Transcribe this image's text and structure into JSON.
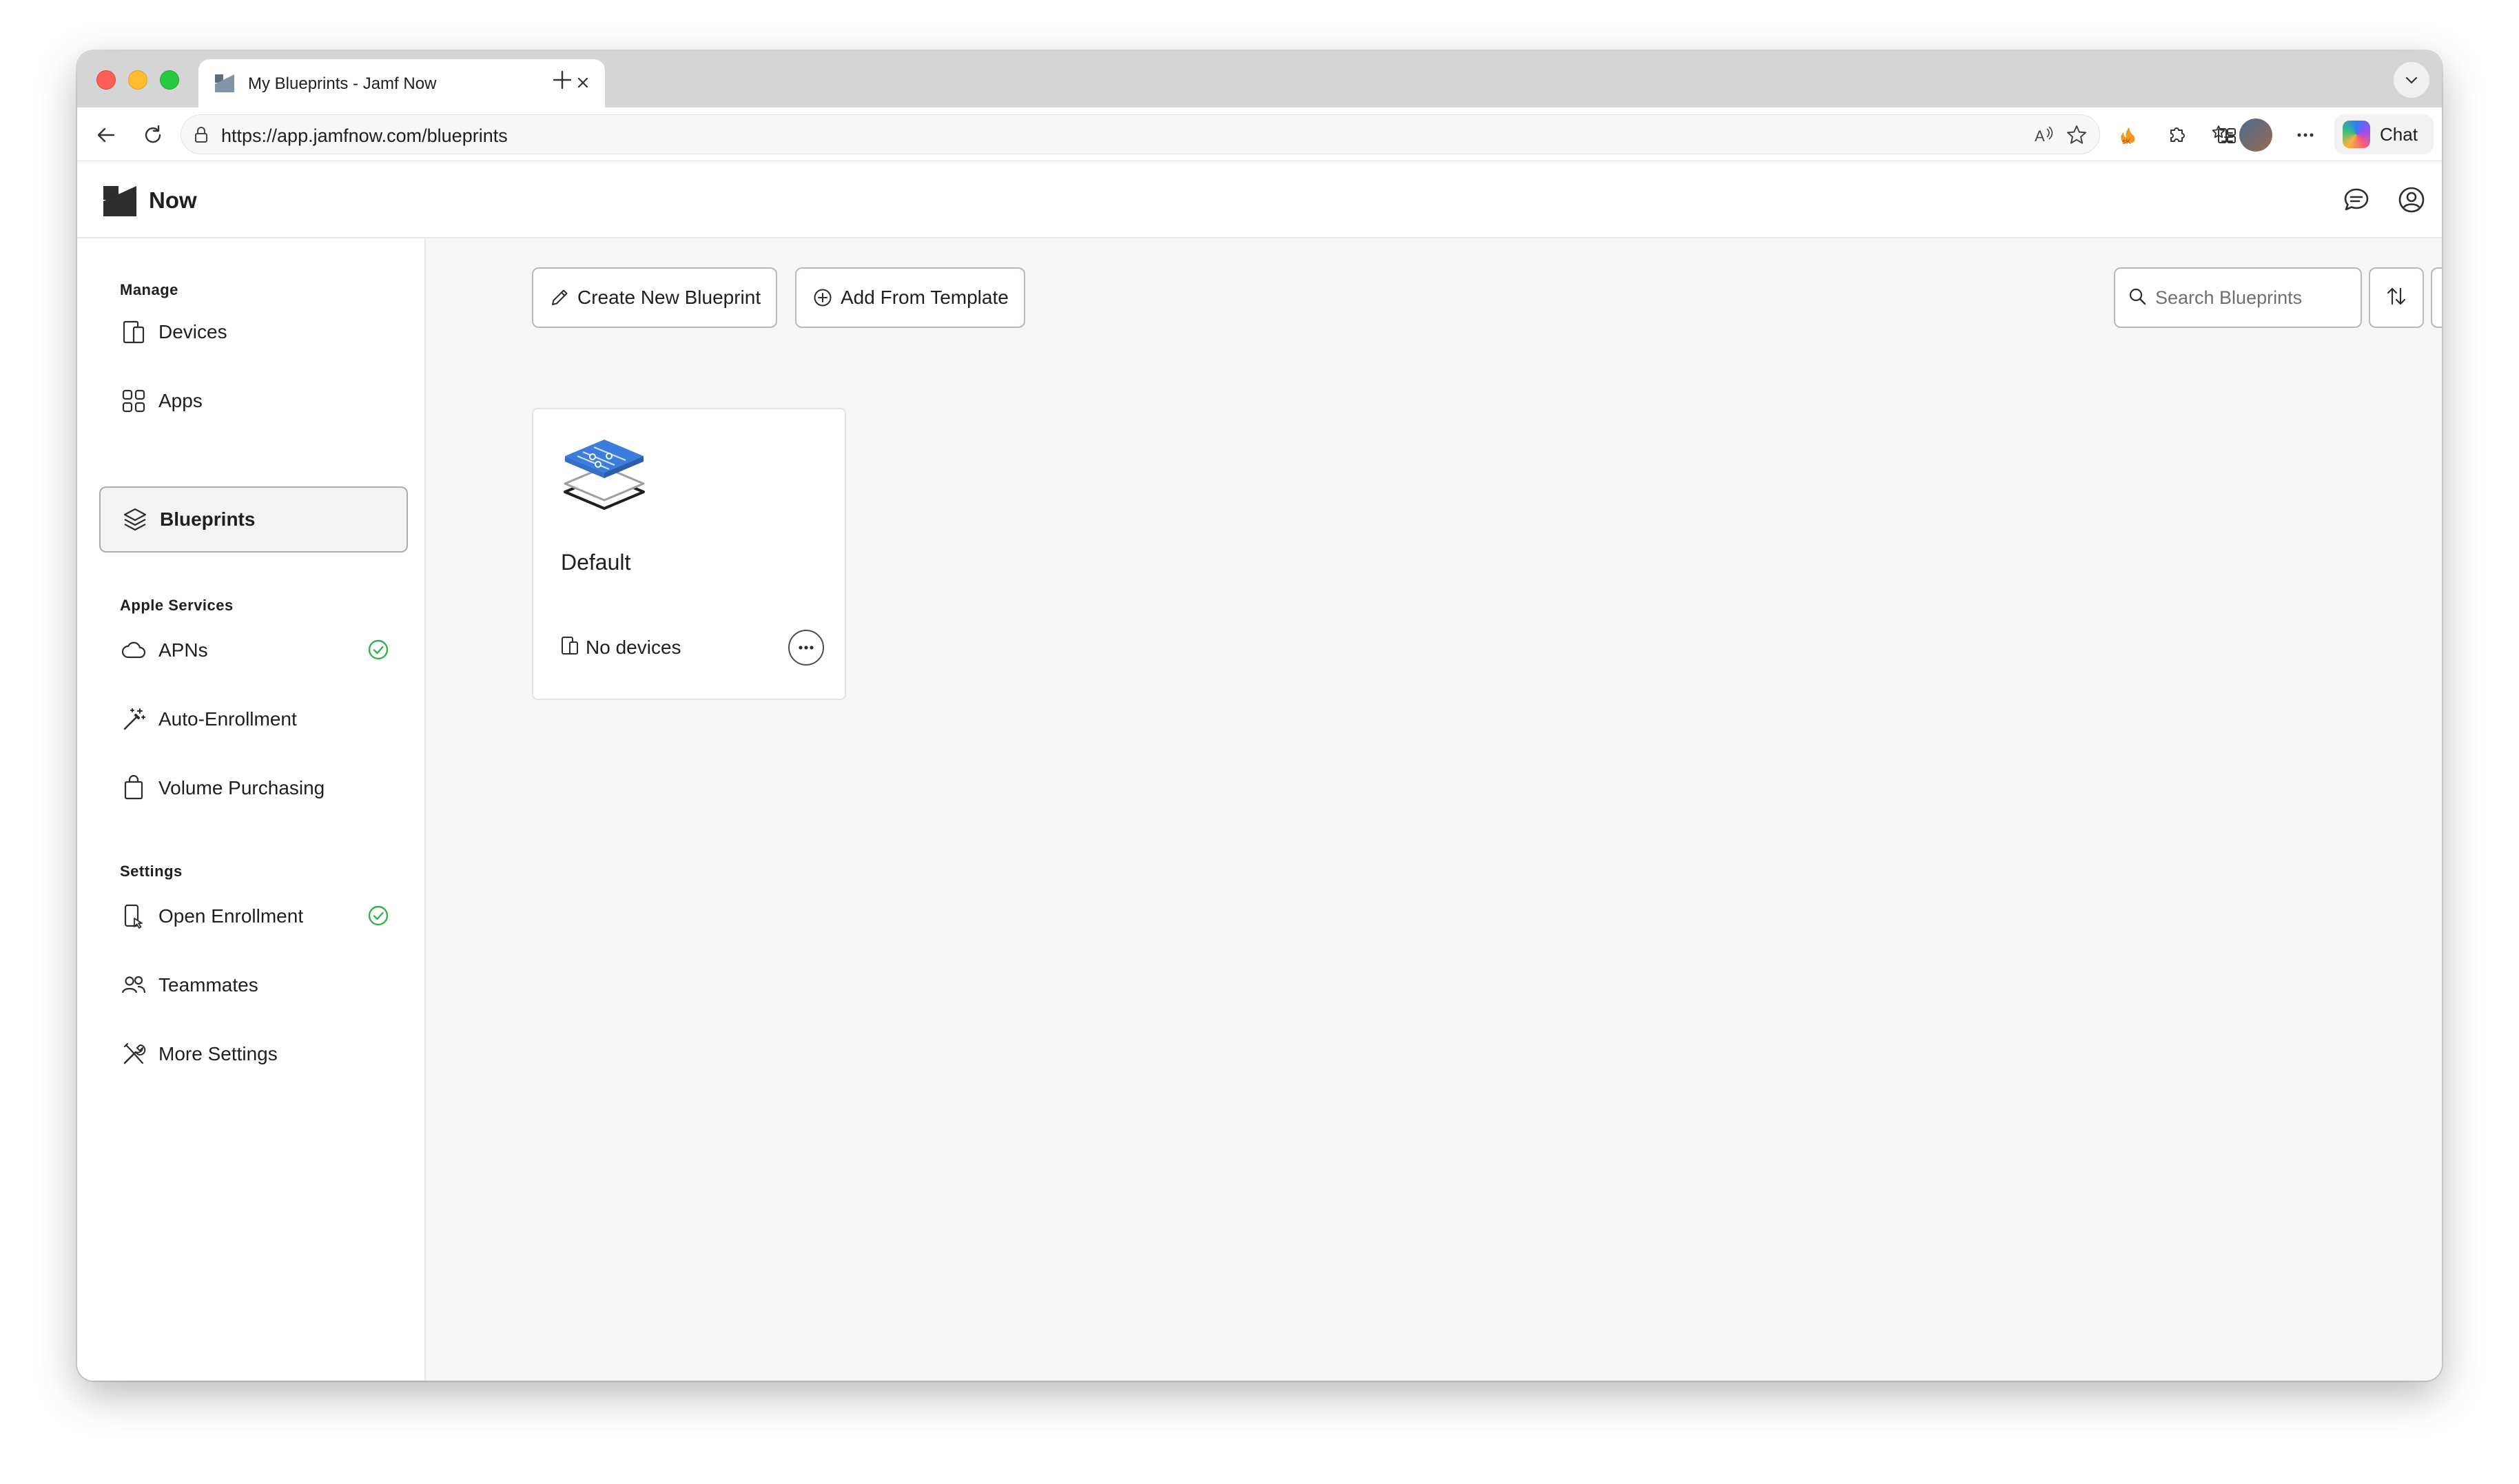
{
  "browser": {
    "tab_title": "My Blueprints - Jamf Now",
    "url": "https://app.jamfnow.com/blueprints",
    "chat_label": "Chat"
  },
  "app": {
    "brand": "Now"
  },
  "sidebar": {
    "sections": [
      {
        "title": "Manage",
        "items": [
          {
            "label": "Devices",
            "icon": "devices-icon"
          },
          {
            "label": "Apps",
            "icon": "apps-grid-icon"
          },
          {
            "label": "Blueprints",
            "icon": "layers-icon",
            "active": true
          }
        ]
      },
      {
        "title": "Apple Services",
        "items": [
          {
            "label": "APNs",
            "icon": "cloud-icon",
            "status": "ok"
          },
          {
            "label": "Auto-Enrollment",
            "icon": "magic-wand-icon"
          },
          {
            "label": "Volume Purchasing",
            "icon": "shopping-bag-icon"
          }
        ]
      },
      {
        "title": "Settings",
        "items": [
          {
            "label": "Open Enrollment",
            "icon": "enrollment-phone-icon",
            "status": "ok"
          },
          {
            "label": "Teammates",
            "icon": "people-icon"
          },
          {
            "label": "More Settings",
            "icon": "tools-icon"
          }
        ]
      }
    ]
  },
  "toolbar": {
    "create_label": "Create New Blueprint",
    "template_label": "Add From Template",
    "search_placeholder": "Search Blueprints"
  },
  "blueprints": [
    {
      "name": "Default",
      "devices_label": "No devices"
    }
  ],
  "colors": {
    "accent_blue": "#3b7ddd",
    "status_ok": "#2fb34a",
    "main_bg": "#f5f6f8"
  }
}
